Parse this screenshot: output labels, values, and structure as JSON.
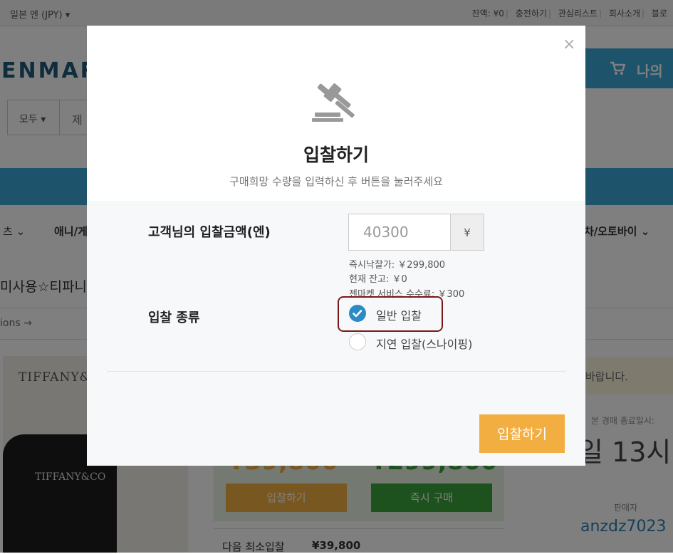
{
  "topbar": {
    "currency": "일본 엔 (JPY) ▾",
    "balance": "잔액: ¥0",
    "charge": "충전하기",
    "wishlist": "관심리스트",
    "about": "회사소개",
    "blog": "블로"
  },
  "header": {
    "logo": "ENMAR",
    "mypage": "나의"
  },
  "search": {
    "scope": "모두 ▾",
    "text": "제"
  },
  "categories": [
    "츠 ⌄",
    "애니/게",
    "차/오토바이 ⌄"
  ],
  "product": {
    "title": "미사용☆티파니",
    "sub": "ions →",
    "image_brand": "TIFFANY&",
    "box_brand": "TIFFANY&CO",
    "buy_price_partial": "¥299,800",
    "bid_price_partial": "¥39,800",
    "bid_button": "입찰하기",
    "buy_button": "즉시 구매",
    "next_bid_label": "다음 최소입찰",
    "next_bid_value": "¥39,800",
    "notice": "바랍니다.",
    "end_label": "본 경매 종료일시:",
    "end_time": "일 13시",
    "seller_label": "판매자",
    "seller": "anzdz7023"
  },
  "modal": {
    "close": "×",
    "title": "입찰하기",
    "subtitle": "구매희망 수량을 입력하신 후 버튼을 눌러주세요",
    "amount_label": "고객님의 입찰금액(엔)",
    "amount_value": "40300",
    "currency_symbol": "¥",
    "buyout_price": "즉시낙찰가: ￥299,800",
    "balance": "현재 잔고: ￥0",
    "fee": "젠마켓 서비스 수수료: ￥300",
    "type_label": "입찰 종류",
    "options": [
      {
        "label": "일반 입찰",
        "selected": true
      },
      {
        "label": "지연 입찰(스나이핑)",
        "selected": false
      }
    ],
    "submit": "입찰하기"
  },
  "colors": {
    "accent_blue": "#3aa8d6",
    "bid_orange": "#f3ae41",
    "buy_green": "#3aa33a",
    "radio_selected": "#2a8bc7",
    "highlight_border": "#7a1818"
  }
}
